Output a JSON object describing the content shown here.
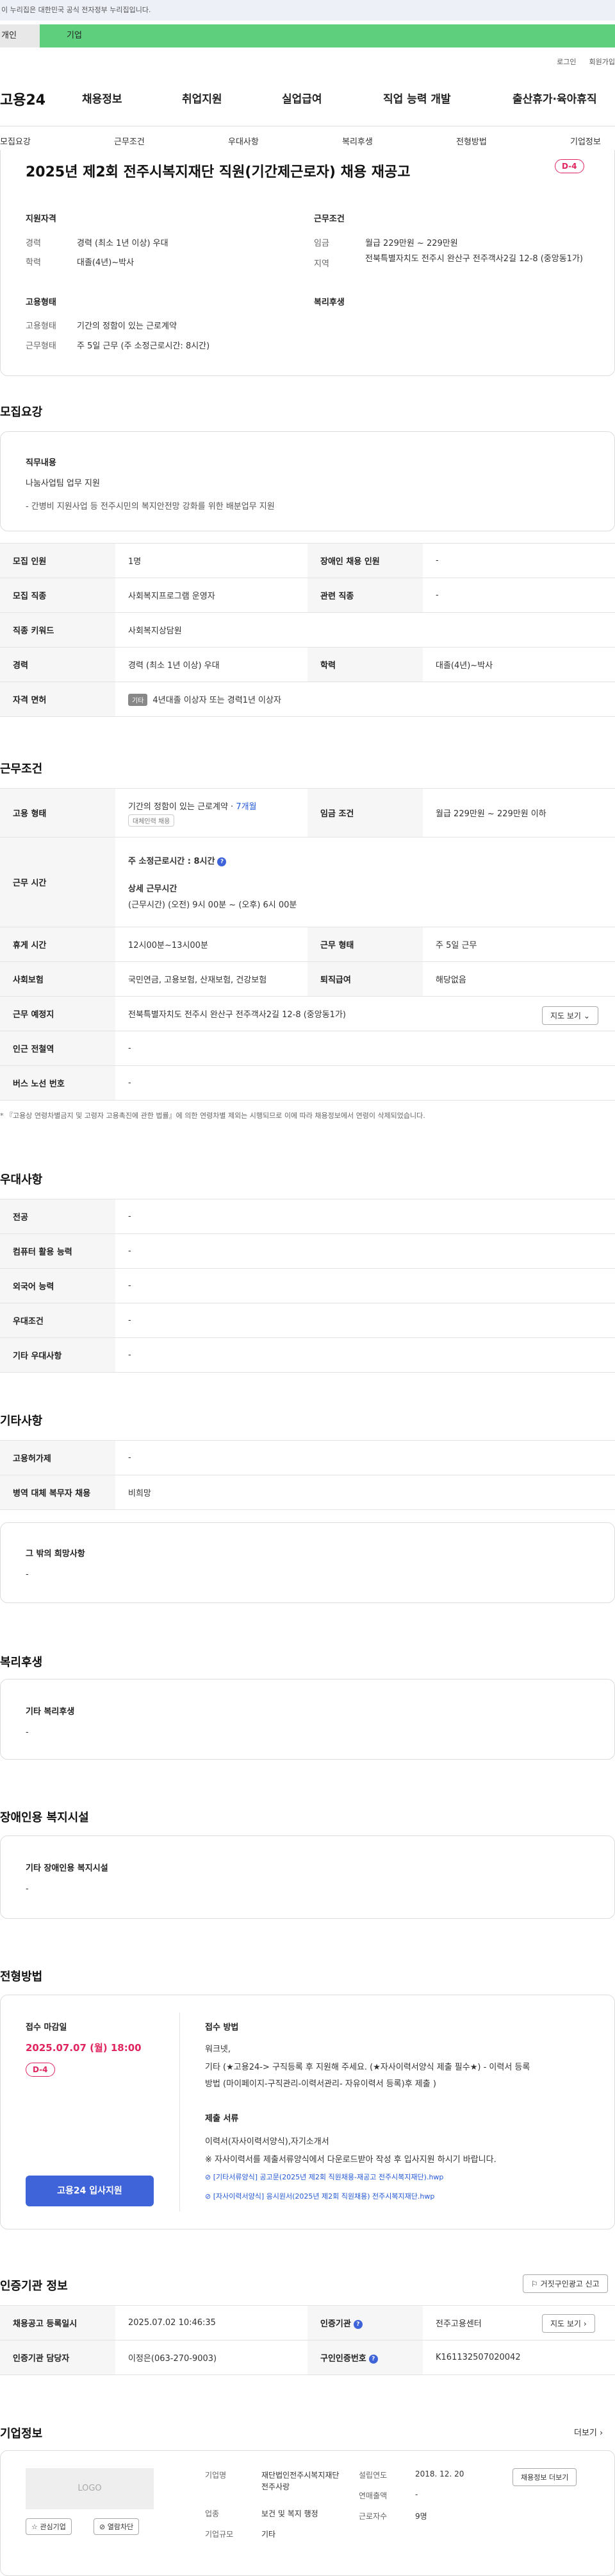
{
  "gov_strip": "이 누리집은 대한민국 공식 전자정부 누리집입니다.",
  "tabs": {
    "personal": "개인",
    "company": "기업"
  },
  "util": {
    "login": "로그인",
    "join": "회원가입"
  },
  "logo": "고용24",
  "gnb": [
    "채용정보",
    "취업지원",
    "실업급여",
    "직업 능력 개발",
    "출산휴가·육아휴직"
  ],
  "subnav": [
    "모집요강",
    "근무조건",
    "우대사항",
    "복리후생",
    "전형방법",
    "기업정보"
  ],
  "summary": {
    "title": "2025년 제2회 전주시복지재단 직원(기간제근로자) 채용 재공고",
    "dday": "D-4",
    "qual_h": "지원자격",
    "career_l": "경력",
    "career_v": "경력 (최소 1년 이상) 우대",
    "edu_l": "학력",
    "edu_v": "대졸(4년)~박사",
    "emp_h": "고용형태",
    "emptype_l": "고용형태",
    "emptype_v": "기간의 정함이 있는 근로계약",
    "worktype_l": "근무형태",
    "worktype_v": "주 5일 근무 (주 소정근로시간: 8시간)",
    "cond_h": "근무조건",
    "wage_l": "임금",
    "wage_v": "월급 229만원 ~ 229만원",
    "region_l": "지역",
    "region_v": "전북특별자치도 전주시 완산구 전주객사2길 12-8 (중앙동1가)",
    "welfare_h": "복리후생"
  },
  "recruit": {
    "title": "모집요강",
    "job_h": "직무내용",
    "job_1": "나눔사업팀 업무 지원",
    "job_2": "- 간병비 지원사업 등 전주시민의 복지안전망 강화를 위한 배분업무 지원",
    "rows": [
      {
        "l1": "모집 인원",
        "v1": "1명",
        "l2": "장애인 채용 인원",
        "v2": "-"
      },
      {
        "l1": "모집 직종",
        "v1": "사회복지프로그램 운영자",
        "l2": "관련 직종",
        "v2": "-"
      },
      {
        "l1": "직종 키워드",
        "v1": "사회복지상담원"
      },
      {
        "l1": "경력",
        "v1": "경력 (최소 1년 이상) 우대",
        "l2": "학력",
        "v2": "대졸(4년)~박사"
      },
      {
        "l1": "자격 면허",
        "chip": "기타",
        "v1": "4년대졸 이상자 또는 경력1년 이상자"
      }
    ]
  },
  "work": {
    "title": "근무조건",
    "emp_l": "고용 형태",
    "emp_v": "기간의 정함이 있는 근로계약 · ",
    "emp_months": "7개월",
    "emp_badge": "대체인력 채용",
    "wage_l": "임금 조건",
    "wage_v": "월급 229만원 ~ 229만원 이하",
    "hours_l": "근무 시간",
    "hours_1": "주 소정근로시간 : 8시간",
    "hours_2": "상세 근무시간",
    "hours_3": "(근무시간) (오전) 9시 00분 ~ (오후) 6시 00분",
    "rest_l": "휴게 시간",
    "rest_v": "12시00분~13시00분",
    "form_l": "근무 형태",
    "form_v": "주 5일 근무",
    "ins_l": "사회보험",
    "ins_v": "국민연금, 고용보험, 산재보험, 건강보험",
    "sev_l": "퇴직급여",
    "sev_v": "해당없음",
    "place_l": "근무 예정지",
    "place_v": "전북특별자치도 전주시 완산구 전주객사2길 12-8 (중앙동1가)",
    "map_btn": "지도 보기",
    "subway_l": "인근 전철역",
    "subway_v": "-",
    "bus_l": "버스 노선 번호",
    "bus_v": "-",
    "note": "* 『고용상 연령차별금지 및 고령자 고용촉진에 관한 법률』에 의한 연령차별 제외는 시행되므로 이에 따라 채용정보에서 연령이 삭제되었습니다."
  },
  "pref": {
    "title": "우대사항",
    "rows": [
      {
        "l": "전공",
        "v": "-"
      },
      {
        "l": "컴퓨터 활용 능력",
        "v": "-"
      },
      {
        "l": "외국어 능력",
        "v": "-"
      },
      {
        "l": "우대조건",
        "v": "-"
      },
      {
        "l": "기타 우대사항",
        "v": "-"
      }
    ]
  },
  "etc": {
    "title": "기타사항",
    "rows": [
      {
        "l": "고용허가제",
        "v": "-"
      },
      {
        "l": "병역 대체 복무자 채용",
        "v": "비희망"
      }
    ],
    "other_h": "그 밖의 희망사항",
    "other_v": "-"
  },
  "welfare": {
    "title": "복리후생",
    "h": "기타 복리후생",
    "v": "-"
  },
  "disabled": {
    "title": "장애인용 복지시설",
    "h": "기타 장애인용 복지시설",
    "v": "-"
  },
  "process": {
    "title": "전형방법",
    "deadline_h": "접수 마감일",
    "deadline_v": "2025.07.07 (월) 18:00",
    "dday": "D-4",
    "method_h": "접수 방법",
    "method_1": "워크넷,",
    "method_2": "기타 (★고용24-> 구직등록 후 지원해 주세요. (★자사이력서양식 제출 필수★) - 이력서 등록",
    "method_3": "방법 (마이페이지-구직관리-이력서관리- 자유이력서 등록)후 제출 )",
    "docs_h": "제출 서류",
    "docs_1": "이력서(자사이력서양식),자기소개서",
    "docs_2": "※ 자사이력서를 제출서류양식에서 다운로드받아 작성 후 입사지원 하시기 바랍니다.",
    "file_1": "[기타서류양식] 공고문(2025년 제2회 직원채용-재공고 전주시복지재단).hwp",
    "file_2": "[자사이력서양식] 응시원서(2025년 제2회 직원채용) 전주시복지재단.hwp",
    "apply": "고용24 입사지원"
  },
  "cert": {
    "title": "인증기관 정보",
    "report_btn": "거짓구인광고 신고",
    "reg_l": "채용공고 등록일시",
    "reg_v": "2025.07.02 10:46:35",
    "org_l": "인증기관",
    "org_v": "전주고용센터",
    "map_btn": "지도 보기",
    "mgr_l": "인증기관 담당자",
    "mgr_v": "이정은(063-270-9003)",
    "num_l": "구인인증번호",
    "num_v": "K161132507020042"
  },
  "company": {
    "title": "기업정보",
    "more": "더보기",
    "logo": "LOGO",
    "fav_btn": "관심기업",
    "block_btn": "열람차단",
    "name_l": "기업명",
    "name_v": "재단법인전주시복지재단전주사랑",
    "ind_l": "업종",
    "ind_v": "보건 및 복지 행정",
    "size_l": "기업규모",
    "size_v": "기타",
    "est_l": "설립연도",
    "est_v": "2018. 12. 20",
    "sales_l": "연매출액",
    "sales_v": "-",
    "emp_l": "근로자수",
    "emp_v": "9명",
    "jobs_btn": "채용정보 더보기"
  }
}
